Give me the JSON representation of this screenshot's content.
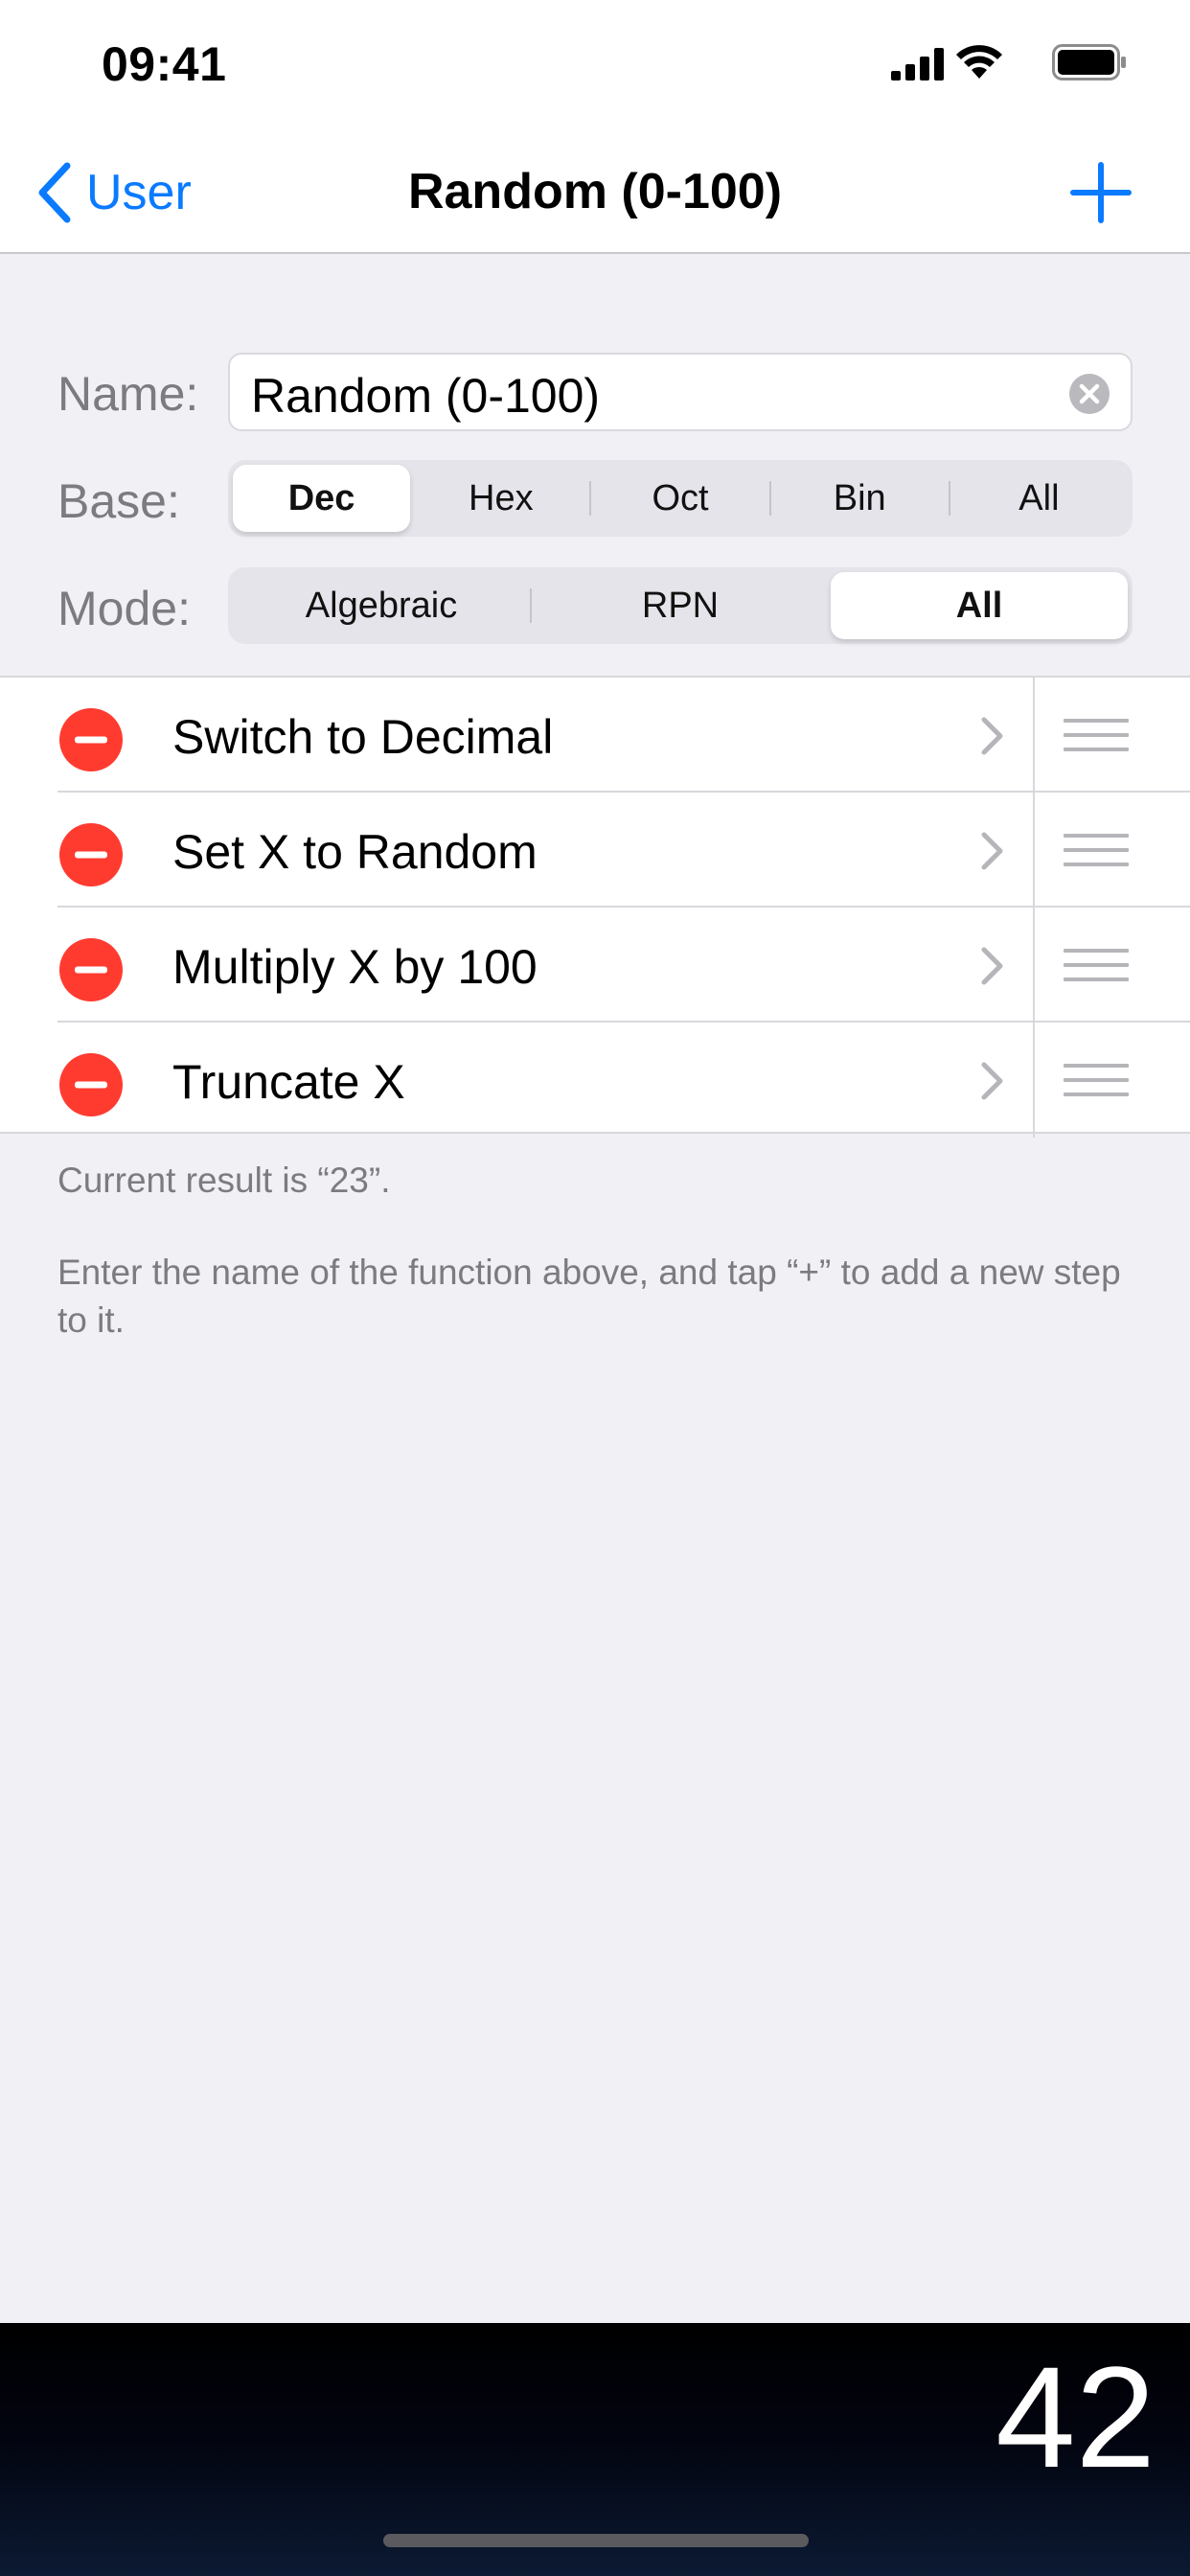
{
  "status_bar": {
    "time": "09:41",
    "icons": [
      "signal-icon",
      "wifi-icon",
      "battery-icon"
    ]
  },
  "nav": {
    "back_label": "User",
    "title": "Random (0-100)",
    "add_icon": "plus-icon"
  },
  "form": {
    "name_label": "Name:",
    "name_value": "Random (0-100)",
    "base_label": "Base:",
    "base_options": [
      "Dec",
      "Hex",
      "Oct",
      "Bin",
      "All"
    ],
    "base_selected": "Dec",
    "mode_label": "Mode:",
    "mode_options": [
      "Algebraic",
      "RPN",
      "All"
    ],
    "mode_selected": "All"
  },
  "steps": [
    {
      "label": "Switch to Decimal"
    },
    {
      "label": "Set X to Random"
    },
    {
      "label": "Multiply X by 100"
    },
    {
      "label": "Truncate X"
    }
  ],
  "footer": {
    "result_text": "Current result is “23”.",
    "help_text": "Enter the name of the function above, and tap “+” to add a new step to it."
  },
  "display": {
    "value": "42"
  },
  "colors": {
    "accent": "#0a7aff",
    "delete": "#ff3b30",
    "background": "#f0f0f5"
  }
}
